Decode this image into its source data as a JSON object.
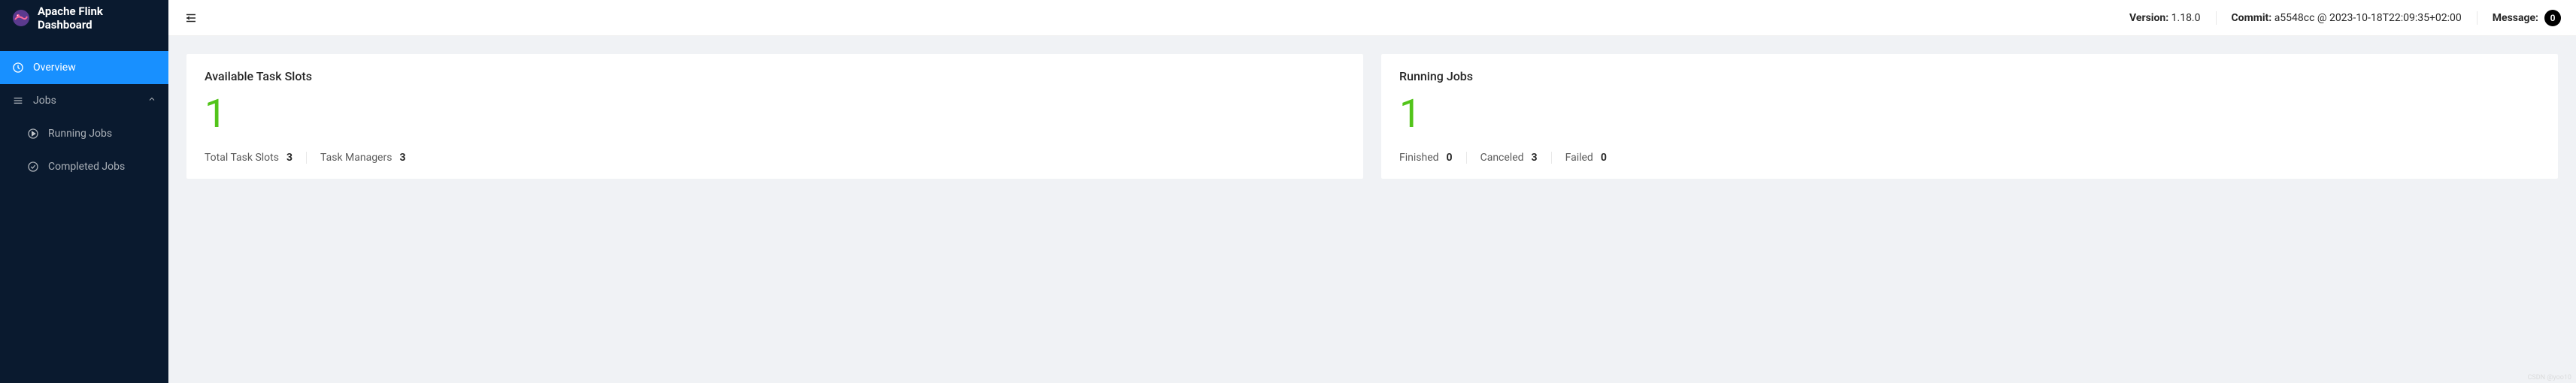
{
  "app": {
    "title": "Apache Flink Dashboard"
  },
  "header": {
    "version_label": "Version:",
    "version_value": "1.18.0",
    "commit_label": "Commit:",
    "commit_value": "a5548cc @ 2023-10-18T22:09:35+02:00",
    "message_label": "Message:",
    "message_count": "0"
  },
  "nav": {
    "overview": "Overview",
    "jobs": "Jobs",
    "running_jobs": "Running Jobs",
    "completed_jobs": "Completed Jobs"
  },
  "cards": {
    "slots": {
      "title": "Available Task Slots",
      "value": "1",
      "total_label": "Total Task Slots",
      "total_value": "3",
      "managers_label": "Task Managers",
      "managers_value": "3"
    },
    "jobs": {
      "title": "Running Jobs",
      "value": "1",
      "finished_label": "Finished",
      "finished_value": "0",
      "canceled_label": "Canceled",
      "canceled_value": "3",
      "failed_label": "Failed",
      "failed_value": "0"
    }
  },
  "watermark": "CSDN @yoo10"
}
